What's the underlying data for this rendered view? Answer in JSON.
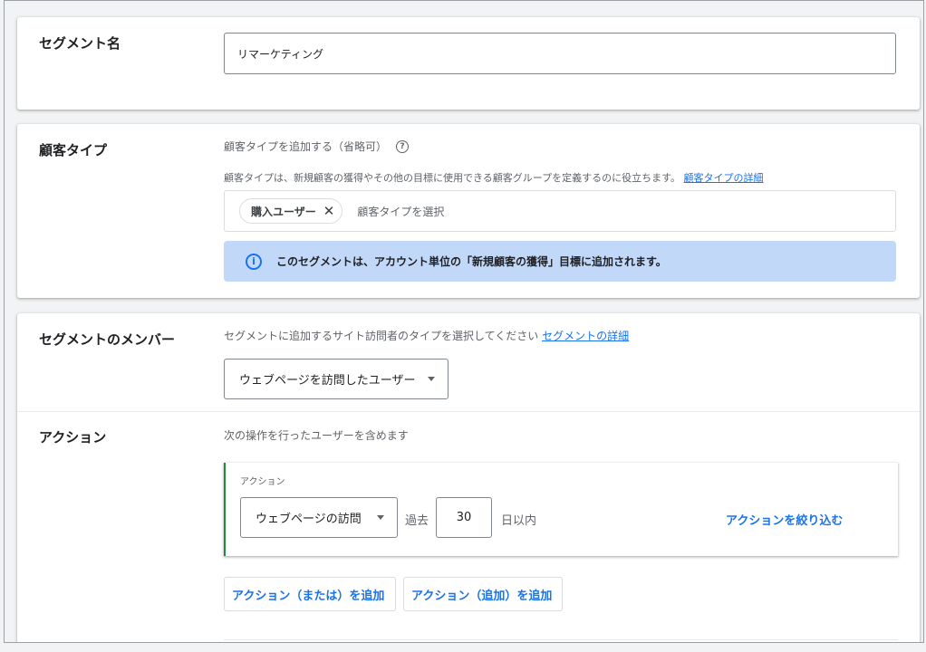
{
  "segment_name": {
    "title": "セグメント名",
    "value": "リマーケティング"
  },
  "customer_type": {
    "title": "顧客タイプ",
    "add_label": "顧客タイプを追加する（省略可）",
    "help_icon": "help-circle-icon",
    "description": "顧客タイプは、新規顧客の獲得やその他の目標に使用できる顧客グループを定義するのに役立ちます。",
    "details_link": "顧客タイプの詳細",
    "chip_label": "購入ユーザー",
    "chip_remove_icon": "close-icon",
    "select_placeholder": "顧客タイプを選択",
    "info_icon": "info-icon",
    "info_text": "このセグメントは、アカウント単位の「新規顧客の獲得」目標に追加されます。",
    "info_color": "#c2d8f8"
  },
  "members": {
    "title": "セグメントのメンバー",
    "description": "セグメントに追加するサイト訪問者のタイプを選択してください",
    "details_link": "セグメントの詳細",
    "dropdown_value": "ウェブページを訪問したユーザー"
  },
  "action": {
    "title": "アクション",
    "description": "次の操作を行ったユーザーを含めます",
    "box_label": "アクション",
    "visit_dropdown_value": "ウェブページの訪問",
    "past_label": "過去",
    "days_value": "30",
    "days_suffix": "日以内",
    "refine_link": "アクションを絞り込む",
    "accent_color": "#1e8e3e",
    "add_or_button": "アクション（または）を追加",
    "add_and_button": "アクション（追加）を追加"
  },
  "link_color": "#1a73e8"
}
